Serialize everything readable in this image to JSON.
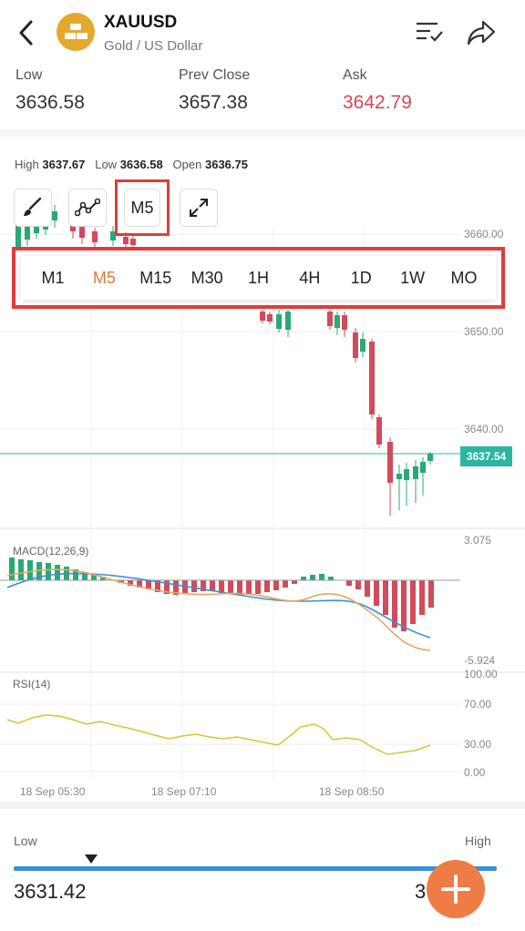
{
  "header": {
    "symbol": "XAUUSD",
    "subtitle": "Gold / US Dollar",
    "back_icon": "chevron-left-icon",
    "list_icon": "list-check-icon",
    "share_icon": "share-icon"
  },
  "quote": {
    "low_label": "Low",
    "low_value": "3636.58",
    "prev_close_label": "Prev Close",
    "prev_close_value": "3657.38",
    "ask_label": "Ask",
    "ask_value": "3642.79",
    "ask_color": "#d24b5a"
  },
  "stats": {
    "high_label": "High",
    "high_value": "3637.67",
    "low_label": "Low",
    "low_value": "3636.58",
    "open_label": "Open",
    "open_value": "3636.75"
  },
  "toolbar": {
    "timeframe": "M5"
  },
  "timeframes": [
    "M1",
    "M5",
    "M15",
    "M30",
    "1H",
    "4H",
    "1D",
    "1W",
    "MO"
  ],
  "active_timeframe": "M5",
  "chart": {
    "price_axis": [
      "3660.00",
      "3650.00",
      "3640.00"
    ],
    "current_price": "3637.54",
    "macd_label": "MACD(12,26,9)",
    "macd_max": "3.075",
    "macd_min": "-5.924",
    "rsi_label": "RSI(14)",
    "rsi_axis": [
      "100.00",
      "70.00",
      "30.00",
      "0.00"
    ],
    "time_labels": [
      "18 Sep 05:30",
      "18 Sep 07:10",
      "18 Sep 08:50"
    ]
  },
  "range": {
    "low_label": "Low",
    "high_label": "High",
    "low_value": "3631.42",
    "high_value_partial": "3"
  }
}
